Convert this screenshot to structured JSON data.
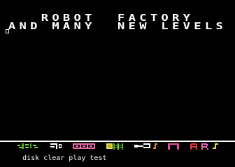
{
  "screen": {
    "background": "#000000",
    "foreground": "#ffffff"
  },
  "title": {
    "line1": "ROBOT  FACTORY",
    "line2": "AND MANY  NEW LEVELS"
  },
  "palette": {
    "tiles": [
      {
        "icon": "green-creature-tile-icon",
        "color": "#7cd63c"
      },
      {
        "icon": "white-pipe-tile-icon",
        "color": "#ffffff"
      },
      {
        "icon": "pink-brick-tile-icon",
        "color": "#e86aa8"
      },
      {
        "icon": "yellow-crate-tile-icon",
        "color": "#e6d84a"
      },
      {
        "icon": "green-ladder-tile-icon",
        "color": "#48a81c"
      },
      {
        "icon": "white-key-tile-icon",
        "color": "#ffffff"
      },
      {
        "icon": "orange-hook-tile-icon",
        "color": "#e8862a"
      },
      {
        "icon": "pink-arch-tile-icon",
        "color": "#e84aa0"
      },
      {
        "icon": "red-letter-a-tile-icon",
        "color": "#e83a3a"
      },
      {
        "icon": "pink-letter-r-tile-icon",
        "color": "#e86ab0"
      },
      {
        "icon": "yellow-hook-tile-icon",
        "color": "#e6d84a"
      }
    ]
  },
  "menu": {
    "disk": "disk",
    "clear": "clear",
    "play": "play",
    "test": "test"
  }
}
